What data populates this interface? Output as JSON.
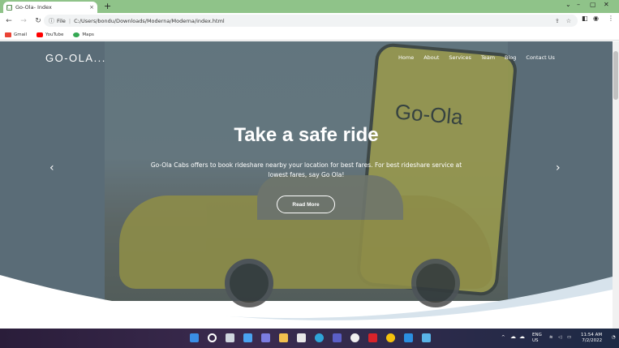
{
  "browser": {
    "tab_title": "Go-Ola- Index",
    "url_scheme_label": "File",
    "url": "C:/Users/bondu/Downloads/Moderna/Moderna/index.html",
    "bookmarks": [
      {
        "label": "Gmail",
        "icon": "gmail-icon",
        "color": "#ea4335"
      },
      {
        "label": "YouTube",
        "icon": "youtube-icon",
        "color": "#ff0000"
      },
      {
        "label": "Maps",
        "icon": "maps-icon",
        "color": "#34a853"
      }
    ]
  },
  "site": {
    "brand": "GO-OLA...",
    "nav": [
      "Home",
      "About",
      "Services",
      "Team",
      "Blog",
      "Contact Us"
    ],
    "hero_title": "Take a safe ride",
    "hero_text": "Go-Ola Cabs offers to book rideshare nearby your location for best fares. For best rideshare service at lowest fares, say Go Ola!",
    "cta_label": "Read More",
    "phone_logo": "Go-Ola",
    "prev_arrow": "‹",
    "next_arrow": "›"
  },
  "taskbar": {
    "lang_primary": "ENG",
    "lang_secondary": "US",
    "time": "11:54 AM",
    "date": "7/2/2022"
  },
  "colors": {
    "tabstrip": "#8fc389",
    "hero_overlay": "#6b7c85",
    "taxi_yellow": "#c8bf45",
    "wave_accent": "#d7e3ec"
  }
}
